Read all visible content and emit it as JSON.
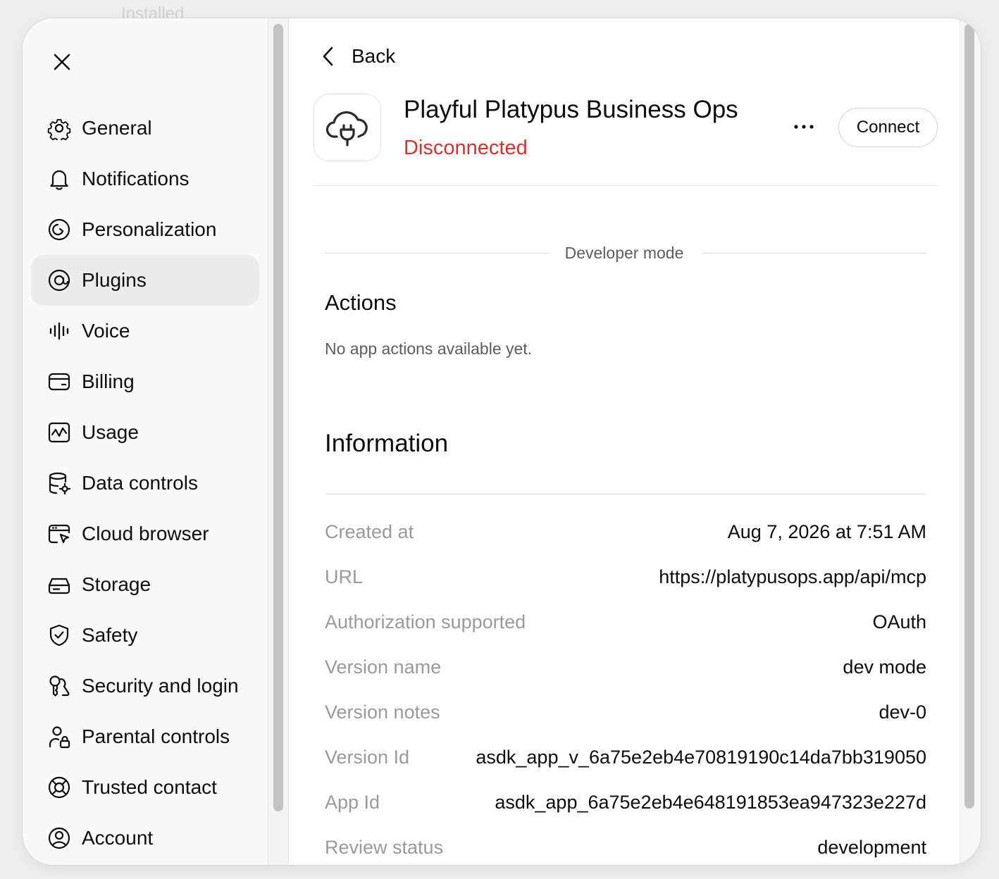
{
  "background": {
    "breadcrumb": "Installed"
  },
  "sidebar": {
    "items": [
      {
        "label": "General",
        "icon": "gear-icon"
      },
      {
        "label": "Notifications",
        "icon": "bell-icon"
      },
      {
        "label": "Personalization",
        "icon": "personalization-icon"
      },
      {
        "label": "Plugins",
        "icon": "plugins-icon",
        "active": true
      },
      {
        "label": "Voice",
        "icon": "waveform-icon"
      },
      {
        "label": "Billing",
        "icon": "credit-card-icon"
      },
      {
        "label": "Usage",
        "icon": "usage-chart-icon"
      },
      {
        "label": "Data controls",
        "icon": "database-gear-icon"
      },
      {
        "label": "Cloud browser",
        "icon": "cloud-browser-icon"
      },
      {
        "label": "Storage",
        "icon": "storage-drive-icon"
      },
      {
        "label": "Safety",
        "icon": "shield-check-icon"
      },
      {
        "label": "Security and login",
        "icon": "security-icon"
      },
      {
        "label": "Parental controls",
        "icon": "parental-controls-icon"
      },
      {
        "label": "Trusted contact",
        "icon": "lifebuoy-icon"
      },
      {
        "label": "Account",
        "icon": "account-icon"
      }
    ]
  },
  "main": {
    "back_label": "Back",
    "app": {
      "name": "Playful Platypus Business Ops",
      "status": "Disconnected",
      "status_color": "#e02e2a",
      "icon": "cloud-plug-icon"
    },
    "connect_label": "Connect",
    "developer_mode_label": "Developer mode",
    "actions": {
      "heading": "Actions",
      "empty_text": "No app actions available yet."
    },
    "information": {
      "heading": "Information",
      "rows": [
        {
          "key": "Created at",
          "value": "Aug 7, 2026 at 7:51 AM"
        },
        {
          "key": "URL",
          "value": "https://platypusops.app/api/mcp"
        },
        {
          "key": "Authorization supported",
          "value": "OAuth"
        },
        {
          "key": "Version name",
          "value": "dev mode"
        },
        {
          "key": "Version notes",
          "value": "dev-0"
        },
        {
          "key": "Version Id",
          "value": "asdk_app_v_6a75e2eb4e70819190c14da7bb319050"
        },
        {
          "key": "App Id",
          "value": "asdk_app_6a75e2eb4e648191853ea947323e227d"
        },
        {
          "key": "Review status",
          "value": "development"
        }
      ]
    }
  }
}
